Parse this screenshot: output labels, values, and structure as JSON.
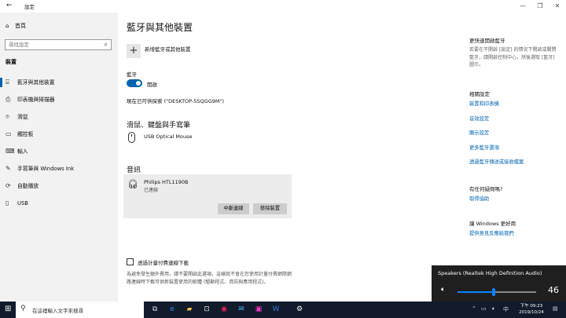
{
  "window": {
    "title": "設定",
    "controls": [
      "—",
      "❐",
      "✕"
    ]
  },
  "nav": {
    "home": "首頁",
    "search_placeholder": "尋找設定",
    "section": "裝置",
    "items": [
      {
        "label": "藍牙與其他裝置",
        "icon": "bluetooth-icon",
        "glyph": "⌸"
      },
      {
        "label": "印表機與掃描器",
        "icon": "printer-icon",
        "glyph": "⎙"
      },
      {
        "label": "滑鼠",
        "icon": "mouse-icon",
        "glyph": "⌾"
      },
      {
        "label": "觸控板",
        "icon": "touchpad-icon",
        "glyph": "▭"
      },
      {
        "label": "輸入",
        "icon": "keyboard-icon",
        "glyph": "⌨"
      },
      {
        "label": "手寫筆與 Windows Ink",
        "icon": "pen-icon",
        "glyph": "✎"
      },
      {
        "label": "自動播放",
        "icon": "autoplay-icon",
        "glyph": "⟳"
      },
      {
        "label": "USB",
        "icon": "usb-icon",
        "glyph": "▯"
      }
    ]
  },
  "main": {
    "title": "藍牙與其他裝置",
    "add_device": "新增藍牙或其他裝置",
    "bluetooth_label": "藍牙",
    "bluetooth_state": "開啟",
    "discoverable": "現在已可供探索 (\"DESKTOP-5SQGG9M\")",
    "mouse_section": "滑鼠、鍵盤與手寫筆",
    "mouse_device": "USB Optical Mouse",
    "audio_section": "音訊",
    "audio_device": {
      "name": "Philips HTL1190B",
      "status": "已連線",
      "disconnect": "中斷連線",
      "remove": "移除裝置"
    },
    "metered_label": "透過計量付費連線下載",
    "metered_note": "為避免發生額外費用，請不要開啟此選項，這樣就不會在您使用計量付費網際網路連線時下載可供新裝置使用的軟體 (驅動程式、資訊與應用程式)。"
  },
  "right": {
    "faster_title": "更快速開啟藍牙",
    "faster_text": "若要在不開啟 [設定] 的情況下開啟或關閉藍牙，請開啟控制中心，然後選取 [藍牙] 圖示。",
    "related_title": "相關設定",
    "related_links": [
      "裝置和印表機",
      "音效設定",
      "顯示設定",
      "更多藍牙選項",
      "透過藍牙傳送或接收檔案"
    ],
    "help_title": "有任何疑問嗎?",
    "help_link": "取得協助",
    "better_title": "讓 Windows 更好用",
    "better_link": "提供意見反應給我們"
  },
  "volume": {
    "device": "Speakers (Realtek High Definition Audio)",
    "level": 46
  },
  "taskbar": {
    "search_placeholder": "在這裡輸入文字來搜尋",
    "time": "下午 09:23",
    "date": "2019/10/24"
  }
}
